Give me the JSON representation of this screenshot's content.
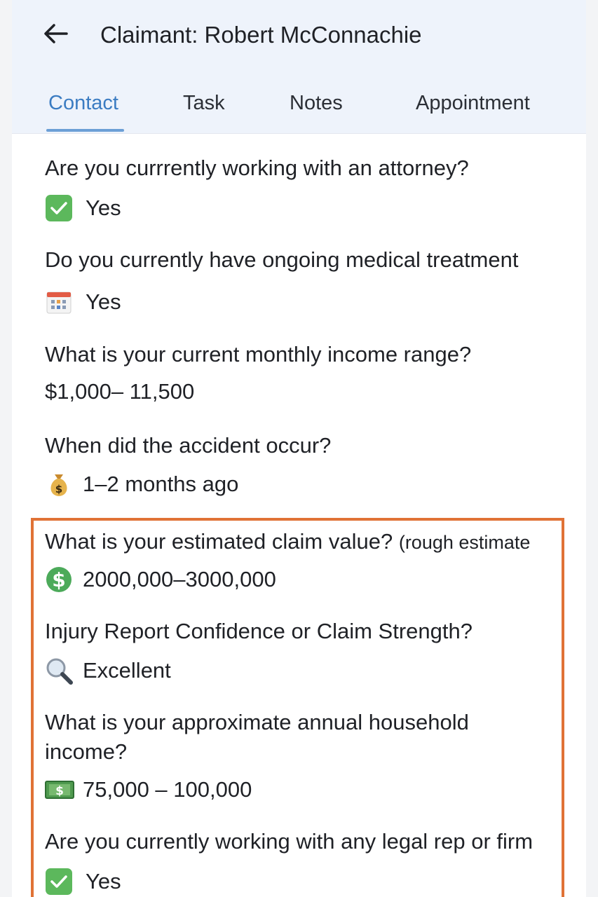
{
  "header": {
    "title": "Claimant: Robert McConnachie",
    "tabs": [
      {
        "label": "Contact",
        "active": true
      },
      {
        "label": "Task"
      },
      {
        "label": "Notes"
      },
      {
        "label": "Appointment"
      }
    ]
  },
  "questions": [
    {
      "question": "Are you currrently working with an attorney?",
      "answer": "Yes",
      "icon": "check-icon"
    },
    {
      "question": "Do you currently have ongoing medical treatment",
      "answer": "Yes",
      "icon": "calendar-icon"
    },
    {
      "question": "What is your current monthly income range?",
      "answer": "$1,000– 11,500"
    },
    {
      "question": "When did the accident occur?",
      "answer": "1–2 months ago",
      "icon": "money-bag-icon"
    },
    {
      "question": "What is your estimated claim value?",
      "question_note": "(rough estimate",
      "answer": "2000,000–3000,000",
      "icon": "dollar-circle-icon"
    },
    {
      "question": "Injury Report Confidence or Claim Strength?",
      "answer": "Excellent",
      "icon": "magnifier-icon"
    },
    {
      "question_line1": "What is your approximate annual household",
      "question_line2": "income?",
      "answer": "75,000 – 100,000",
      "icon": "dollar-bill-icon"
    },
    {
      "question": "Are you currently working with any legal rep or firm",
      "answer": "Yes",
      "icon": "check-icon"
    }
  ],
  "colors": {
    "accent": "#3b7cc2",
    "highlight_border": "#e07236",
    "check_green": "#5cb85c"
  }
}
